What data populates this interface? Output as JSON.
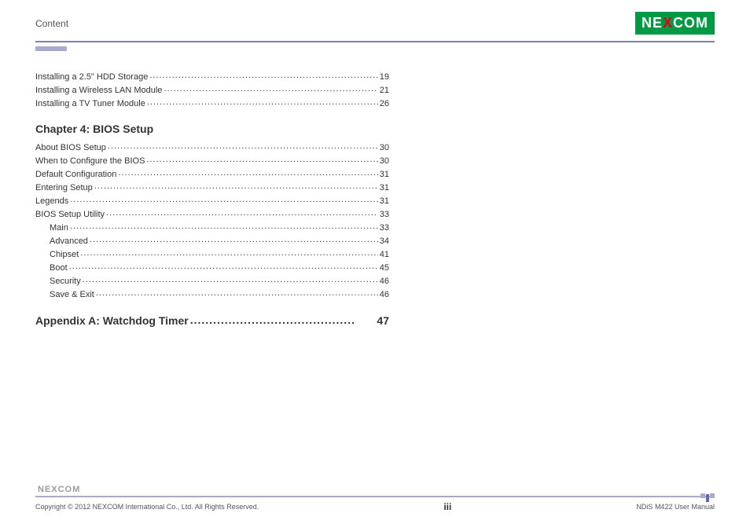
{
  "header": {
    "section": "Content",
    "logo": "NEXCOM"
  },
  "toc": {
    "preChapterItems": [
      {
        "title": "Installing a 2.5\" HDD Storage",
        "page": "19",
        "indent": false
      },
      {
        "title": "Installing a Wireless LAN Module",
        "page": "21",
        "indent": false
      },
      {
        "title": "Installing a TV Tuner Module",
        "page": "26",
        "indent": false
      }
    ],
    "chapter4": {
      "heading": "Chapter 4: BIOS Setup",
      "items": [
        {
          "title": "About BIOS Setup",
          "page": "30",
          "indent": false
        },
        {
          "title": "When to Configure the BIOS",
          "page": "30",
          "indent": false
        },
        {
          "title": "Default Configuration",
          "page": "31",
          "indent": false
        },
        {
          "title": "Entering Setup",
          "page": "31",
          "indent": false
        },
        {
          "title": "Legends",
          "page": "31",
          "indent": false
        },
        {
          "title": "BIOS Setup Utility",
          "page": "33",
          "indent": false
        },
        {
          "title": "Main",
          "page": "33",
          "indent": true
        },
        {
          "title": "Advanced",
          "page": "34",
          "indent": true
        },
        {
          "title": "Chipset",
          "page": "41",
          "indent": true
        },
        {
          "title": "Boot",
          "page": "45",
          "indent": true
        },
        {
          "title": "Security",
          "page": "46",
          "indent": true
        },
        {
          "title": "Save & Exit",
          "page": "46",
          "indent": true
        }
      ]
    },
    "appendixA": {
      "title": "Appendix A: Watchdog Timer",
      "page": "47"
    }
  },
  "footer": {
    "logo": "NEXCOM",
    "copyright": "Copyright © 2012 NEXCOM International Co., Ltd. All Rights Reserved.",
    "pageNumber": "iii",
    "manual": "NDiS M422 User Manual"
  }
}
